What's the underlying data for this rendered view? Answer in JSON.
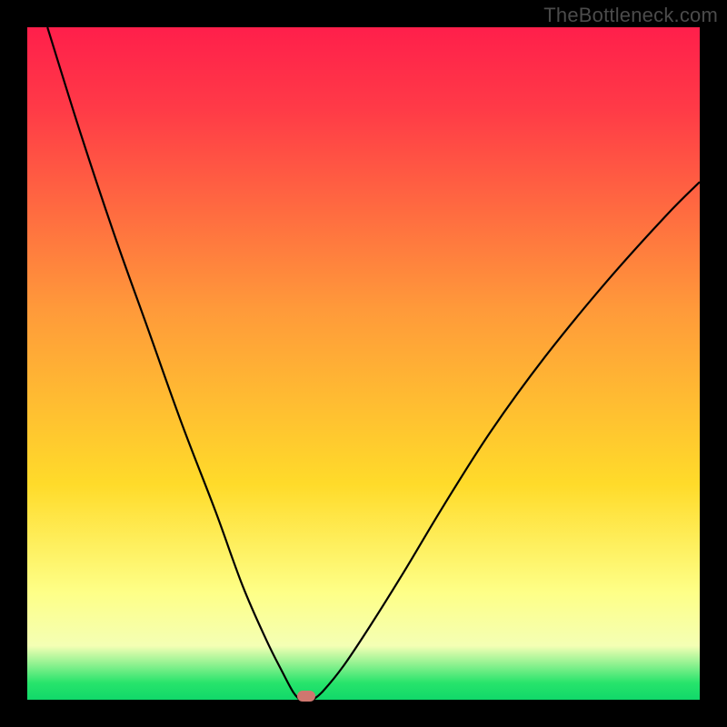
{
  "watermark": "TheBottleneck.com",
  "colors": {
    "red": "#ff1f4b",
    "red2": "#ff3a47",
    "orange": "#ff9a3a",
    "yellow": "#ffdb2a",
    "lyellow": "#feff87",
    "lyellow2": "#f4ffb4",
    "green": "#27e46b",
    "green2": "#11d86a",
    "marker": "#cf776f",
    "curve": "#000000"
  },
  "chart_data": {
    "type": "line",
    "title": "",
    "xlabel": "",
    "ylabel": "",
    "xlim": [
      0,
      100
    ],
    "ylim": [
      0,
      100
    ],
    "series": [
      {
        "name": "left-branch",
        "x": [
          3,
          8,
          13,
          18,
          23,
          28,
          32,
          35.5,
          38,
          39.5,
          40.5
        ],
        "y": [
          100,
          84,
          69,
          55,
          41,
          28,
          17,
          9,
          4,
          1.2,
          0
        ]
      },
      {
        "name": "right-branch",
        "x": [
          42.5,
          44,
          47,
          51,
          56,
          62,
          69,
          77,
          86,
          95,
          100
        ],
        "y": [
          0,
          1.3,
          5,
          11,
          19,
          29,
          40,
          51,
          62,
          72,
          77
        ]
      }
    ],
    "marker": {
      "x_pct": 41.5,
      "y_pct": 99.4
    },
    "notes": "V-shaped bottleneck curve; minimum near x≈41% of width. y=0 is bottom (green), y=100 is top (red)."
  }
}
